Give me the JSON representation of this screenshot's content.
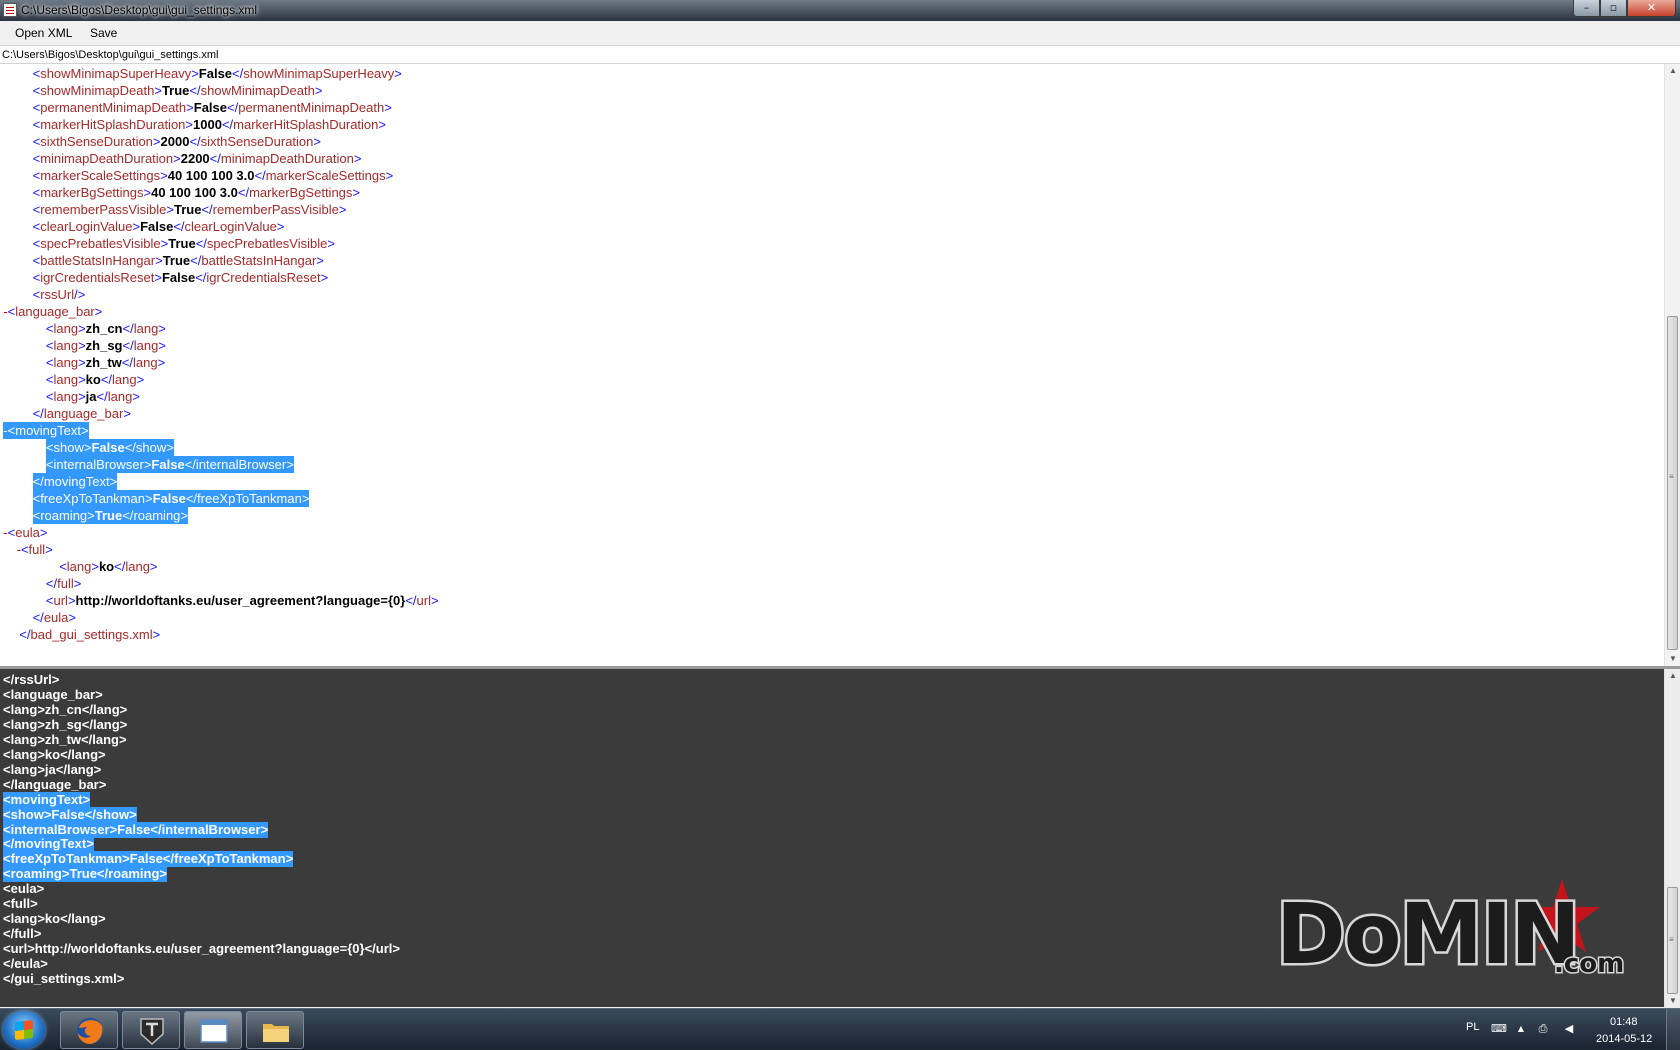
{
  "window": {
    "title": "C:\\Users\\Bigos\\Desktop\\gui\\gui_settings.xml",
    "min_glyph": "–",
    "max_glyph": "▫",
    "close_glyph": "✕"
  },
  "menu": {
    "open_xml": "Open XML",
    "save": "Save"
  },
  "path": "C:\\Users\\Bigos\\Desktop\\gui\\gui_settings.xml",
  "xml_tree": {
    "lines": [
      {
        "indent": 2,
        "open": "showMinimapSuperHeavy",
        "value": "False"
      },
      {
        "indent": 2,
        "open": "showMinimapDeath",
        "value": "True"
      },
      {
        "indent": 2,
        "open": "permanentMinimapDeath",
        "value": "False"
      },
      {
        "indent": 2,
        "open": "markerHitSplashDuration",
        "value": "1000"
      },
      {
        "indent": 2,
        "open": "sixthSenseDuration",
        "value": "2000"
      },
      {
        "indent": 2,
        "open": "minimapDeathDuration",
        "value": "2200"
      },
      {
        "indent": 2,
        "open": "markerScaleSettings",
        "value": "40 100 100 3.0"
      },
      {
        "indent": 2,
        "open": "markerBgSettings",
        "value": "40 100 100 3.0"
      },
      {
        "indent": 2,
        "open": "rememberPassVisible",
        "value": "True"
      },
      {
        "indent": 2,
        "open": "clearLoginValue",
        "value": "False"
      },
      {
        "indent": 2,
        "open": "specPrebatlesVisible",
        "value": "True"
      },
      {
        "indent": 2,
        "open": "battleStatsInHangar",
        "value": "True"
      },
      {
        "indent": 2,
        "open": "igrCredentialsReset",
        "value": "False"
      },
      {
        "indent": 2,
        "selfclose": "rssUrl"
      },
      {
        "indent": 1,
        "marker": "-",
        "start": "language_bar"
      },
      {
        "indent": 3,
        "open": "lang",
        "value": "zh_cn"
      },
      {
        "indent": 3,
        "open": "lang",
        "value": "zh_sg"
      },
      {
        "indent": 3,
        "open": "lang",
        "value": "zh_tw"
      },
      {
        "indent": 3,
        "open": "lang",
        "value": "ko"
      },
      {
        "indent": 3,
        "open": "lang",
        "value": "ja"
      },
      {
        "indent": 2,
        "end": "language_bar"
      },
      {
        "indent": 1,
        "marker": "-",
        "start": "movingText",
        "selected": true
      },
      {
        "indent": 3,
        "open": "show",
        "value": "False",
        "selected": true
      },
      {
        "indent": 3,
        "open": "internalBrowser",
        "value": "False",
        "selected": true
      },
      {
        "indent": 2,
        "end": "movingText",
        "selected": true
      },
      {
        "indent": 2,
        "open": "freeXpToTankman",
        "value": "False",
        "selected": true
      },
      {
        "indent": 2,
        "open": "roaming",
        "value": "True",
        "selected": true
      },
      {
        "indent": 1,
        "marker": "-",
        "start": "eula"
      },
      {
        "indent": 2,
        "marker": "-",
        "start": "full"
      },
      {
        "indent": 4,
        "open": "lang",
        "value": "ko"
      },
      {
        "indent": 3,
        "end": "full"
      },
      {
        "indent": 3,
        "open": "url",
        "value": "http://worldoftanks.eu/user_agreement?language={0}"
      },
      {
        "indent": 2,
        "end": "eula"
      },
      {
        "indent": 1,
        "end": "bad_gui_settings.xml"
      }
    ]
  },
  "raw_text": {
    "lines": [
      {
        "text": "</rssUrl>"
      },
      {
        "text": "<language_bar>"
      },
      {
        "text": "<lang>zh_cn</lang>"
      },
      {
        "text": "<lang>zh_sg</lang>"
      },
      {
        "text": "<lang>zh_tw</lang>"
      },
      {
        "text": "<lang>ko</lang>"
      },
      {
        "text": "<lang>ja</lang>"
      },
      {
        "text": "</language_bar>"
      },
      {
        "text": "<movingText>",
        "selected": true
      },
      {
        "text": "<show>False</show>",
        "selected": true
      },
      {
        "text": "<internalBrowser>False</internalBrowser>",
        "selected": true
      },
      {
        "text": "</movingText>",
        "selected": true
      },
      {
        "text": "<freeXpToTankman>False</freeXpToTankman>",
        "selected": true
      },
      {
        "text": "<roaming>True</roaming>",
        "selected": true
      },
      {
        "text": "<eula>"
      },
      {
        "text": "<full>"
      },
      {
        "text": "<lang>ko</lang>"
      },
      {
        "text": "</full>"
      },
      {
        "text": "<url>http://worldoftanks.eu/user_agreement?language={0}</url>"
      },
      {
        "text": "</eula>"
      },
      {
        "text": "</gui_settings.xml>"
      }
    ]
  },
  "watermark": {
    "brand": "DoMIN",
    "suffix": ".com"
  },
  "scrollbars": {
    "up_glyph": "▲",
    "down_glyph": "▼",
    "grip_glyph": "≡"
  },
  "taskbar": {
    "language": "PL",
    "time": "01:48",
    "date": "2014-05-12",
    "tray_glyphs": {
      "keyboard": "⌨",
      "arrow": "▲",
      "network": "⎙",
      "volume": "◀"
    },
    "apps": [
      "firefox-icon",
      "wot-icon",
      "xml-editor-icon",
      "explorer-icon"
    ]
  },
  "colors": {
    "tag_name": "#a52a2a",
    "bracket": "#1414ff",
    "value": "#000000",
    "selection": "#3399ff",
    "raw_background": "#3b3b3b"
  }
}
